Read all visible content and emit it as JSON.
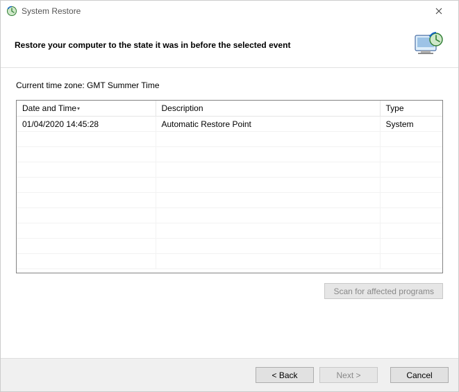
{
  "window": {
    "title": "System Restore"
  },
  "header": {
    "heading": "Restore your computer to the state it was in before the selected event"
  },
  "timezone_label": "Current time zone: GMT Summer Time",
  "table": {
    "columns": {
      "datetime": "Date and Time",
      "description": "Description",
      "type": "Type"
    },
    "rows": [
      {
        "datetime": "01/04/2020 14:45:28",
        "description": "Automatic Restore Point",
        "type": "System"
      }
    ]
  },
  "buttons": {
    "scan": "Scan for affected programs",
    "back": "< Back",
    "next": "Next >",
    "cancel": "Cancel"
  }
}
